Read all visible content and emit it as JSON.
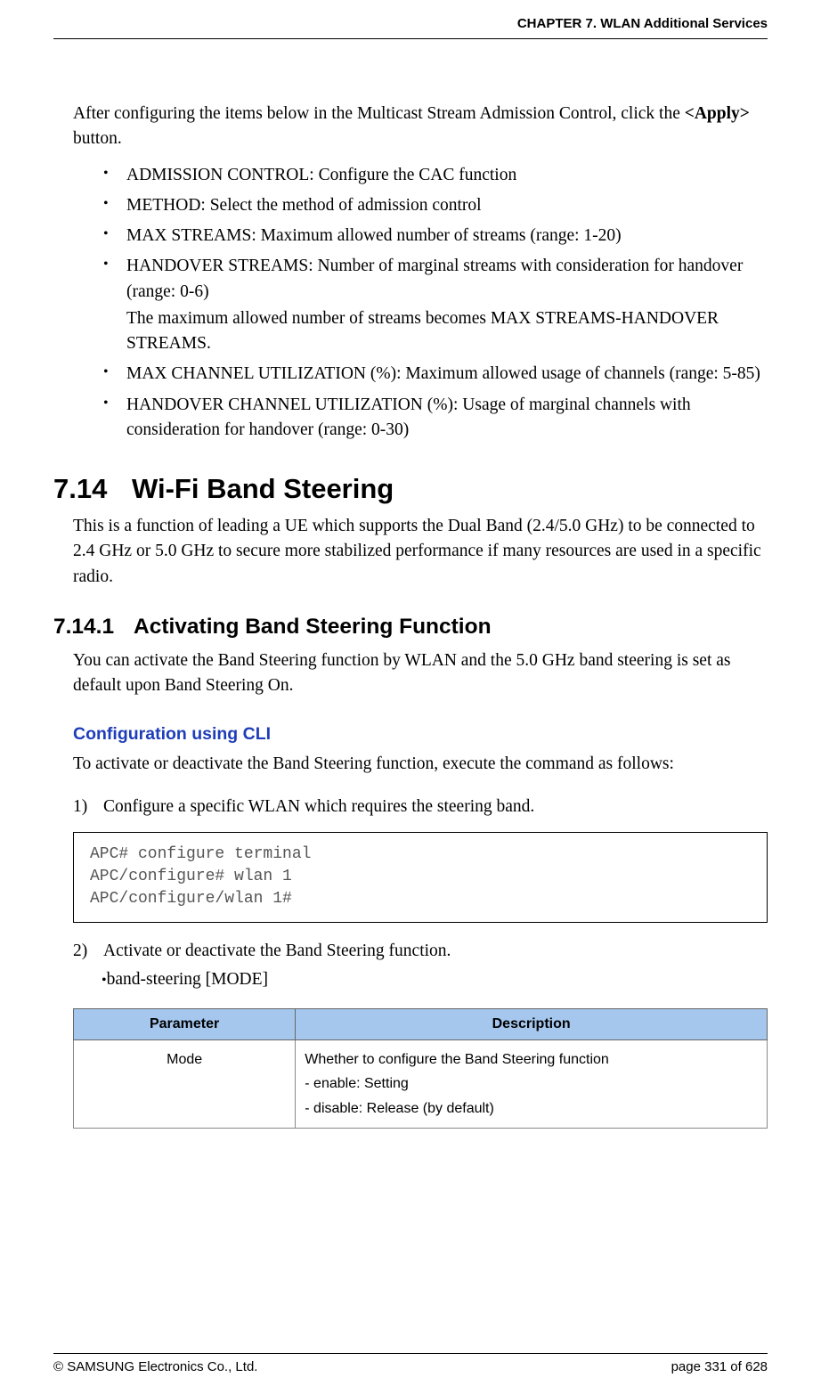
{
  "header": "CHAPTER 7. WLAN Additional Services",
  "intro_pre": "After configuring the items below in the Multicast Stream Admission Control, click the ",
  "intro_bold": "<Apply>",
  "intro_post": " button.",
  "bullets": {
    "b1": "ADMISSION CONTROL: Configure the CAC function",
    "b2": "METHOD: Select the method of admission control",
    "b3": "MAX STREAMS: Maximum allowed number of streams (range: 1-20)",
    "b4a": "HANDOVER STREAMS: Number of marginal streams with consideration for handover (range: 0-6)",
    "b4b": "The maximum allowed number of streams becomes MAX STREAMS-HANDOVER STREAMS.",
    "b5": "MAX CHANNEL UTILIZATION (%): Maximum allowed usage of channels (range: 5-85)",
    "b6": "HANDOVER CHANNEL UTILIZATION (%): Usage of marginal channels with consideration for handover (range: 0-30)"
  },
  "section": {
    "num": "7.14",
    "title": "Wi-Fi Band Steering"
  },
  "section_para": "This is a function of leading a UE which supports the Dual Band (2.4/5.0 GHz) to be connected to 2.4 GHz or 5.0 GHz to secure more stabilized performance if many resources are used in a specific radio.",
  "subsection": {
    "num": "7.14.1",
    "title": "Activating Band Steering Function"
  },
  "subsection_para": "You can activate the Band Steering function by WLAN and the 5.0 GHz band steering is set as default upon Band Steering On.",
  "cli_heading": "Configuration using CLI",
  "cli_para": "To activate or deactivate the Band Steering function, execute the command as follows:",
  "step1": {
    "n": "1)",
    "t": "Configure a specific WLAN which requires the steering band."
  },
  "code": "APC# configure terminal\nAPC/configure# wlan 1\nAPC/configure/wlan 1#",
  "step2": {
    "n": "2)",
    "t": "Activate or deactivate the Band Steering function."
  },
  "step2_bullet": "band-steering [MODE]",
  "table": {
    "h1": "Parameter",
    "h2": "Description",
    "r1c1": "Mode",
    "r1c2": "Whether to configure the Band Steering function\n- enable: Setting\n- disable: Release (by default)"
  },
  "footer_left": "© SAMSUNG Electronics Co., Ltd.",
  "footer_right": "page 331 of 628"
}
